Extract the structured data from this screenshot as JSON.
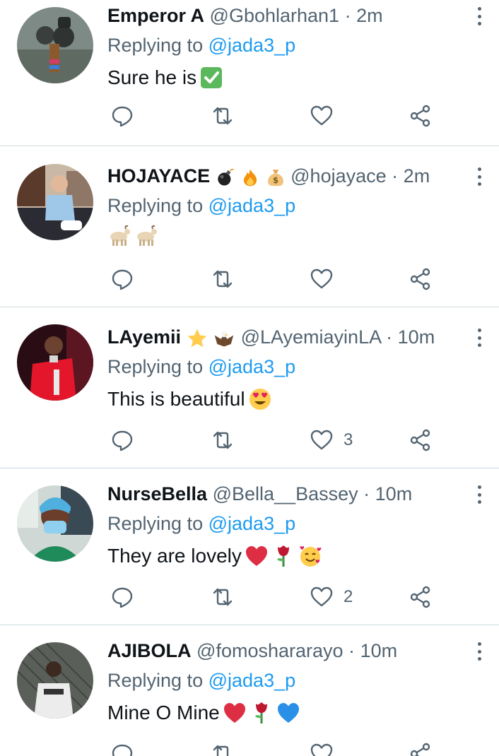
{
  "replying_prefix": "Replying to",
  "tweets": [
    {
      "name": "Emperor A",
      "name_emoji": [],
      "handle": "@Gbohlarhan1",
      "separator": "·",
      "time": "2m",
      "reply_to": "@jada3_p",
      "text": "Sure he is",
      "text_emoji": [
        "check-mark-icon"
      ],
      "likes": ""
    },
    {
      "name": "HOJAYACE",
      "name_emoji": [
        "bomb-icon",
        "fire-icon",
        "money-bag-icon"
      ],
      "handle": "@hojayace",
      "separator": "·",
      "time": "2m",
      "reply_to": "@jada3_p",
      "text": "",
      "text_emoji": [
        "goat-icon",
        "goat-icon"
      ],
      "likes": ""
    },
    {
      "name": "LAyemii",
      "name_emoji": [
        "star-icon",
        "eagle-icon"
      ],
      "handle": "@LAyemiayinLA",
      "separator": "·",
      "time": "10m",
      "reply_to": "@jada3_p",
      "text": "This is beautiful",
      "text_emoji": [
        "heart-eyes-icon"
      ],
      "likes": "3"
    },
    {
      "name": "NurseBella",
      "name_emoji": [],
      "handle": "@Bella__Bassey",
      "separator": "·",
      "time": "10m",
      "reply_to": "@jada3_p",
      "text": "They are lovely",
      "text_emoji": [
        "red-heart-icon",
        "rose-icon",
        "smiling-hearts-icon"
      ],
      "likes": "2"
    },
    {
      "name": "AJIBOLA",
      "name_emoji": [],
      "handle": "@fomoshararayo",
      "separator": "·",
      "time": "10m",
      "reply_to": "@jada3_p",
      "text": "Mine O Mine",
      "text_emoji": [
        "red-heart-icon",
        "rose-icon",
        "blue-heart-icon"
      ],
      "likes": ""
    }
  ],
  "colors": {
    "text": "#0f1419",
    "secondary": "#536471",
    "link": "#1d9bf0",
    "divider": "#cfd9de"
  }
}
